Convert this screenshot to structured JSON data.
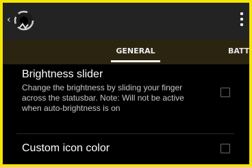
{
  "actionbar": {
    "up_icon": "chevron-left-icon",
    "app_icon": "app-logo-icon",
    "overflow_icon": "more-vert-icon"
  },
  "tabs": [
    {
      "label": "GENERAL",
      "selected": true
    },
    {
      "label": "BATTER"
    }
  ],
  "preferences": [
    {
      "title": "Brightness slider",
      "summary": "Change the brightness by sliding your finger across the statusbar. Note: Will not be active when auto-brightness is on",
      "checked": false
    },
    {
      "title": "Custom icon color",
      "checked": false
    }
  ],
  "colors": {
    "frame_border": "#f5e600",
    "actionbar_bg": "#232323",
    "tabbar_bg": "#2b2410",
    "content_bg": "#000000",
    "text_primary": "#ffffff",
    "text_secondary": "#c8c8c8"
  }
}
